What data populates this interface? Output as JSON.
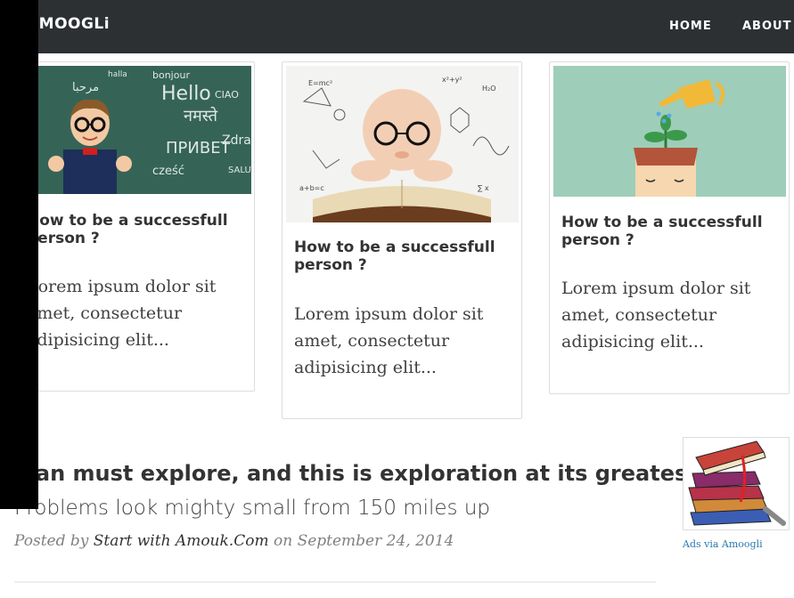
{
  "navbar": {
    "brand": "AMOOGLi",
    "links": [
      "HOME",
      "ABOUT"
    ]
  },
  "cards": [
    {
      "title": "How to be a successfull person ?",
      "excerpt": "Lorem ipsum dolor sit amet, consectetur adipisicing elit..."
    },
    {
      "title": "How to be a successfull person ?",
      "excerpt": "Lorem ipsum dolor sit amet, consectetur adipisicing elit..."
    },
    {
      "title": "How to be a successfull person ?",
      "excerpt": "Lorem ipsum dolor sit amet, consectetur adipisicing elit..."
    }
  ],
  "chalkboard_words": [
    "halla",
    "bonjour",
    "Hello",
    "नमस्ते",
    "CIAO",
    "ПРИВЕТ",
    "Zdravo",
    "cześć",
    "مرحبا",
    "SALUT"
  ],
  "post": {
    "title": "Man must explore, and this is exploration at its greatest",
    "subtitle": "Problems look mighty small from 150 miles up",
    "meta_prefix": "Posted by",
    "author": "Start with Amouk.Com",
    "meta_on": "on",
    "date": "September 24, 2014"
  },
  "ad": {
    "caption": "Ads via Amoogli",
    "image": "books-stack"
  },
  "colors": {
    "navbar_bg": "#2d3033",
    "chalkboard": "#3a6b5b",
    "card3_bg": "#9ecdb9",
    "ad_link": "#2a7ab0"
  }
}
